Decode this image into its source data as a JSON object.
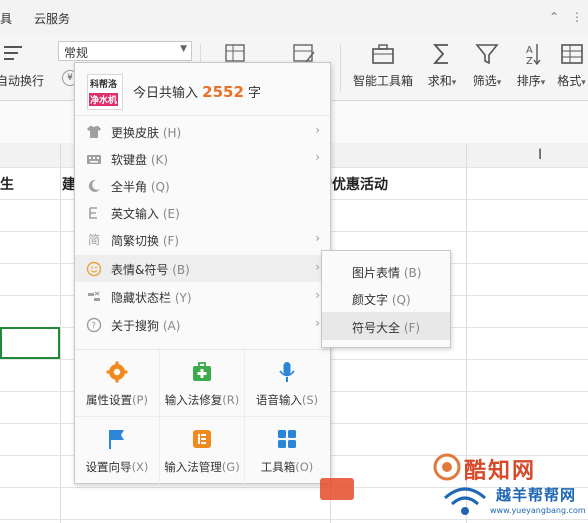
{
  "menubar": {
    "items": [
      "具",
      "云服务"
    ]
  },
  "ribbon": {
    "left_label": "自动换行",
    "format_select": {
      "value": "常规"
    },
    "currency_symbol": "¥",
    "buttons": [
      {
        "label": "智能工具箱",
        "icon": "toolbox-icon",
        "has_dropdown": false
      },
      {
        "label": "求和",
        "icon": "sigma-icon",
        "has_dropdown": true
      },
      {
        "label": "筛选",
        "icon": "filter-icon",
        "has_dropdown": true
      },
      {
        "label": "排序",
        "icon": "sort-icon",
        "has_dropdown": true
      },
      {
        "label": "格式",
        "icon": "format-icon",
        "has_dropdown": true
      }
    ]
  },
  "sheet": {
    "visible_cell_texts": [
      "生",
      "建",
      "的优惠活动"
    ],
    "selection_color": "#1e8a3a"
  },
  "ime_menu": {
    "logo_lines": [
      "科帮洛",
      "净水机"
    ],
    "header_prefix": "今日共输入",
    "header_count": "2552",
    "header_suffix": "字",
    "items": [
      {
        "label": "更换皮肤",
        "hotkey": "(H)",
        "icon": "tshirt-icon",
        "has_submenu": true
      },
      {
        "label": "软键盘",
        "hotkey": "(K)",
        "icon": "keyboard-icon",
        "has_submenu": true
      },
      {
        "label": "全半角",
        "hotkey": "(Q)",
        "icon": "moon-icon",
        "has_submenu": false
      },
      {
        "label": "英文输入",
        "hotkey": "(E)",
        "icon": "english-icon",
        "has_submenu": false
      },
      {
        "label": "简繁切换",
        "hotkey": "(F)",
        "icon": "simplified-traditional-icon",
        "has_submenu": true
      },
      {
        "label": "表情&符号",
        "hotkey": "(B)",
        "icon": "smiley-icon",
        "has_submenu": true,
        "highlighted": true
      },
      {
        "label": "隐藏状态栏",
        "hotkey": "(Y)",
        "icon": "hide-statusbar-icon",
        "has_submenu": true
      },
      {
        "label": "关于搜狗",
        "hotkey": "(A)",
        "icon": "help-icon",
        "has_submenu": true
      }
    ],
    "grid": [
      {
        "label": "属性设置",
        "hotkey": "(P)",
        "icon": "settings-gear-icon",
        "color": "#f08a1c"
      },
      {
        "label": "输入法修复",
        "hotkey": "(R)",
        "icon": "repair-kit-icon",
        "color": "#3cab4a"
      },
      {
        "label": "语音输入",
        "hotkey": "(S)",
        "icon": "microphone-icon",
        "color": "#2a87d8"
      },
      {
        "label": "设置向导",
        "hotkey": "(X)",
        "icon": "flag-icon",
        "color": "#2a87d8"
      },
      {
        "label": "输入法管理",
        "hotkey": "(G)",
        "icon": "manager-icon",
        "color": "#f08a1c"
      },
      {
        "label": "工具箱",
        "hotkey": "(O)",
        "icon": "toolbox-grid-icon",
        "color": "#2a87d8"
      }
    ]
  },
  "submenu": {
    "items": [
      {
        "label": "图片表情",
        "hotkey": "(B)"
      },
      {
        "label": "颜文字",
        "hotkey": "(Q)"
      },
      {
        "label": "符号大全",
        "hotkey": "(F)",
        "highlighted": true
      }
    ]
  },
  "watermark": {
    "brand": "酷知网",
    "site": "越羊帮帮网",
    "url": "www.yueyangbang.com"
  }
}
